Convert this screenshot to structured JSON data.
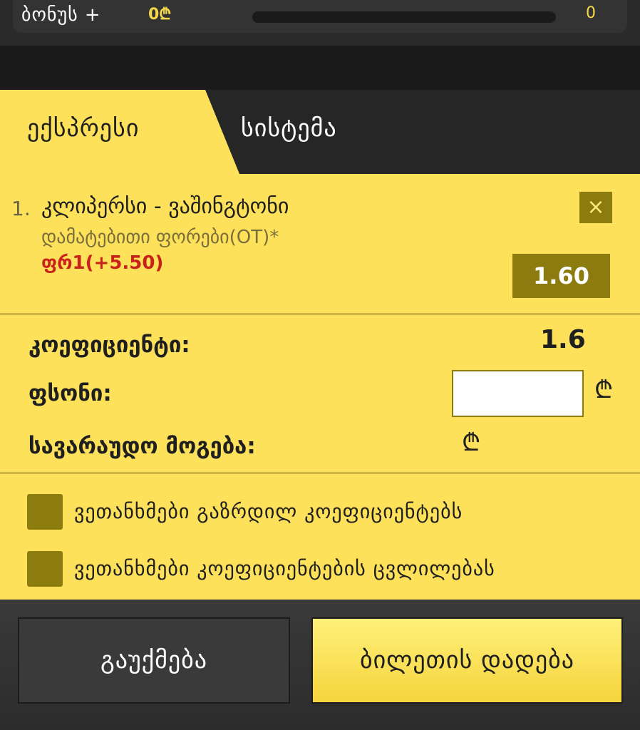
{
  "bonus": {
    "label": "ბონუს +",
    "amount": "0₾",
    "count": "0",
    "progress": 0
  },
  "tabs": {
    "express": "ექსპრესი",
    "system": "სისტემა",
    "active": "express"
  },
  "bet": {
    "index": "1.",
    "match": "კლიპერსი - ვაშინგტონი",
    "market": "დამატებითი ფორები(OT)*",
    "pick": "ფრ1(+5.50)",
    "odds": "1.60",
    "close_icon": "×"
  },
  "summary": {
    "coef_label": "კოეფიციენტი:",
    "coef_value": "1.6",
    "stake_label": "ფსონი:",
    "stake_value": "",
    "currency_icon": "₾",
    "win_label": "სავარაუდო მოგება:"
  },
  "options": {
    "increase_label": "ვეთანხმები გაზრდილ კოეფიციენტებს",
    "change_label": "ვეთანხმები კოეფიციენტების ცვლილებას"
  },
  "buttons": {
    "cancel": "გაუქმება",
    "place": "ბილეთის დადება"
  },
  "colors": {
    "accent": "#fde15a",
    "dark_accent": "#8c7b0e",
    "pick_red": "#c8221a"
  }
}
